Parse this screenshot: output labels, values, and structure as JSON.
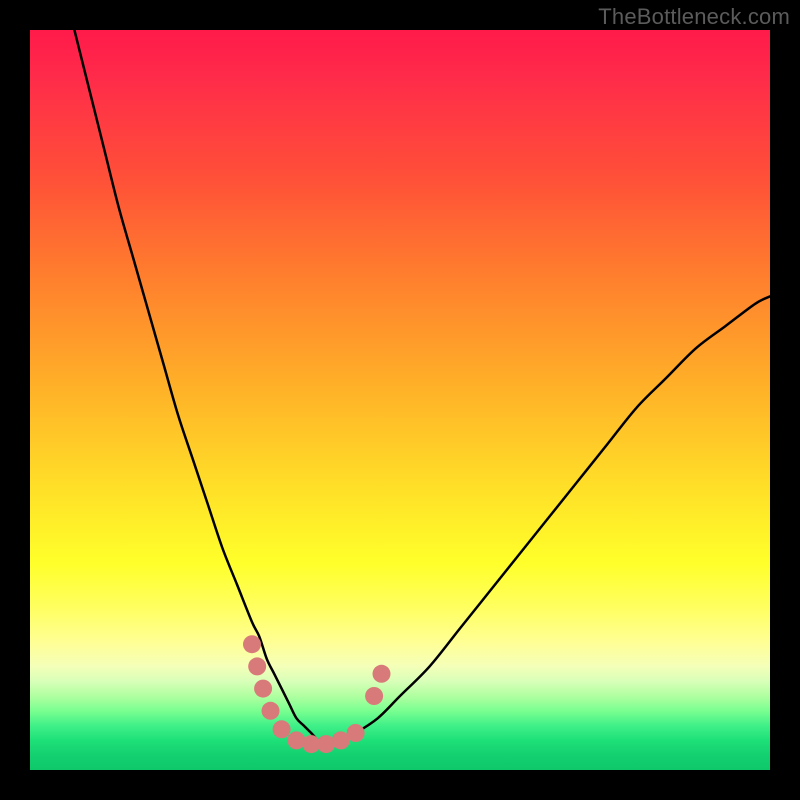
{
  "watermark": "TheBottleneck.com",
  "chart_data": {
    "type": "line",
    "title": "",
    "xlabel": "",
    "ylabel": "",
    "xlim": [
      0,
      100
    ],
    "ylim": [
      0,
      100
    ],
    "grid": false,
    "series": [
      {
        "name": "bottleneck-curve",
        "stroke": "#000000",
        "stroke_width": 2.5,
        "x": [
          6,
          8,
          10,
          12,
          14,
          16,
          18,
          20,
          22,
          24,
          26,
          28,
          30,
          31,
          32,
          33,
          34,
          35,
          36,
          37,
          38,
          39,
          40,
          42,
          44,
          47,
          50,
          54,
          58,
          62,
          66,
          70,
          74,
          78,
          82,
          86,
          90,
          94,
          98,
          100
        ],
        "y": [
          100,
          92,
          84,
          76,
          69,
          62,
          55,
          48,
          42,
          36,
          30,
          25,
          20,
          18,
          15,
          13,
          11,
          9,
          7,
          6,
          5,
          4,
          4,
          4,
          5,
          7,
          10,
          14,
          19,
          24,
          29,
          34,
          39,
          44,
          49,
          53,
          57,
          60,
          63,
          64
        ]
      },
      {
        "name": "marker-dots",
        "stroke": "#d97a7a",
        "marker_radius": 9,
        "points": [
          {
            "x": 30.0,
            "y": 17.0
          },
          {
            "x": 30.7,
            "y": 14.0
          },
          {
            "x": 31.5,
            "y": 11.0
          },
          {
            "x": 32.5,
            "y": 8.0
          },
          {
            "x": 34.0,
            "y": 5.5
          },
          {
            "x": 36.0,
            "y": 4.0
          },
          {
            "x": 38.0,
            "y": 3.5
          },
          {
            "x": 40.0,
            "y": 3.5
          },
          {
            "x": 42.0,
            "y": 4.0
          },
          {
            "x": 44.0,
            "y": 5.0
          },
          {
            "x": 46.5,
            "y": 10.0
          },
          {
            "x": 47.5,
            "y": 13.0
          }
        ]
      }
    ],
    "gradient_stops": [
      {
        "pos": 0,
        "color": "#ff1a4a"
      },
      {
        "pos": 20,
        "color": "#ff5038"
      },
      {
        "pos": 48,
        "color": "#ffb028"
      },
      {
        "pos": 72,
        "color": "#ffff2a"
      },
      {
        "pos": 90,
        "color": "#b0ffa0"
      },
      {
        "pos": 100,
        "color": "#0ec86a"
      }
    ]
  }
}
